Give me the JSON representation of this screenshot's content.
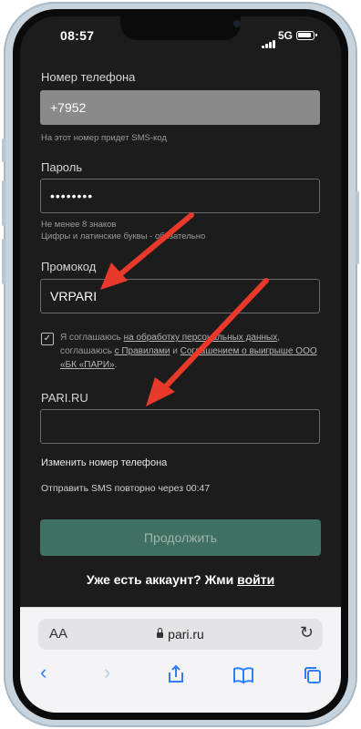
{
  "status": {
    "time": "08:57",
    "network": "5G"
  },
  "phone": {
    "label": "Номер телефона",
    "value": "+7952",
    "hint": "На этот номер придет SMS-код"
  },
  "password": {
    "label": "Пароль",
    "value": "••••••••",
    "hint_line1": "Не менее 8 знаков",
    "hint_line2": "Цифры и латинские буквы - обязательно"
  },
  "promo": {
    "label": "Промокод",
    "value": "VRPARI"
  },
  "consent": {
    "t1": "Я соглашаюсь ",
    "l1": "на обработку персональных данных",
    "t2": ", соглашаюсь ",
    "l2": "с Правилами",
    "t3": " и ",
    "l3": "Соглашением о выигрыше ООО «БК «ПАРИ»",
    "t4": "."
  },
  "code": {
    "label": "PARI.RU",
    "value": ""
  },
  "change_phone": "Изменить номер телефона",
  "resend": "Отправить SMS повторно через 00:47",
  "continue_button": "Продолжить",
  "account": {
    "text": "Уже есть аккаунт? Жми ",
    "link": "войти"
  },
  "browser": {
    "aa": "AA",
    "url": "pari.ru"
  },
  "colors": {
    "button_bg": "#3f7061",
    "arrow": "#e8392a",
    "link_blue": "#2f7ef6"
  }
}
